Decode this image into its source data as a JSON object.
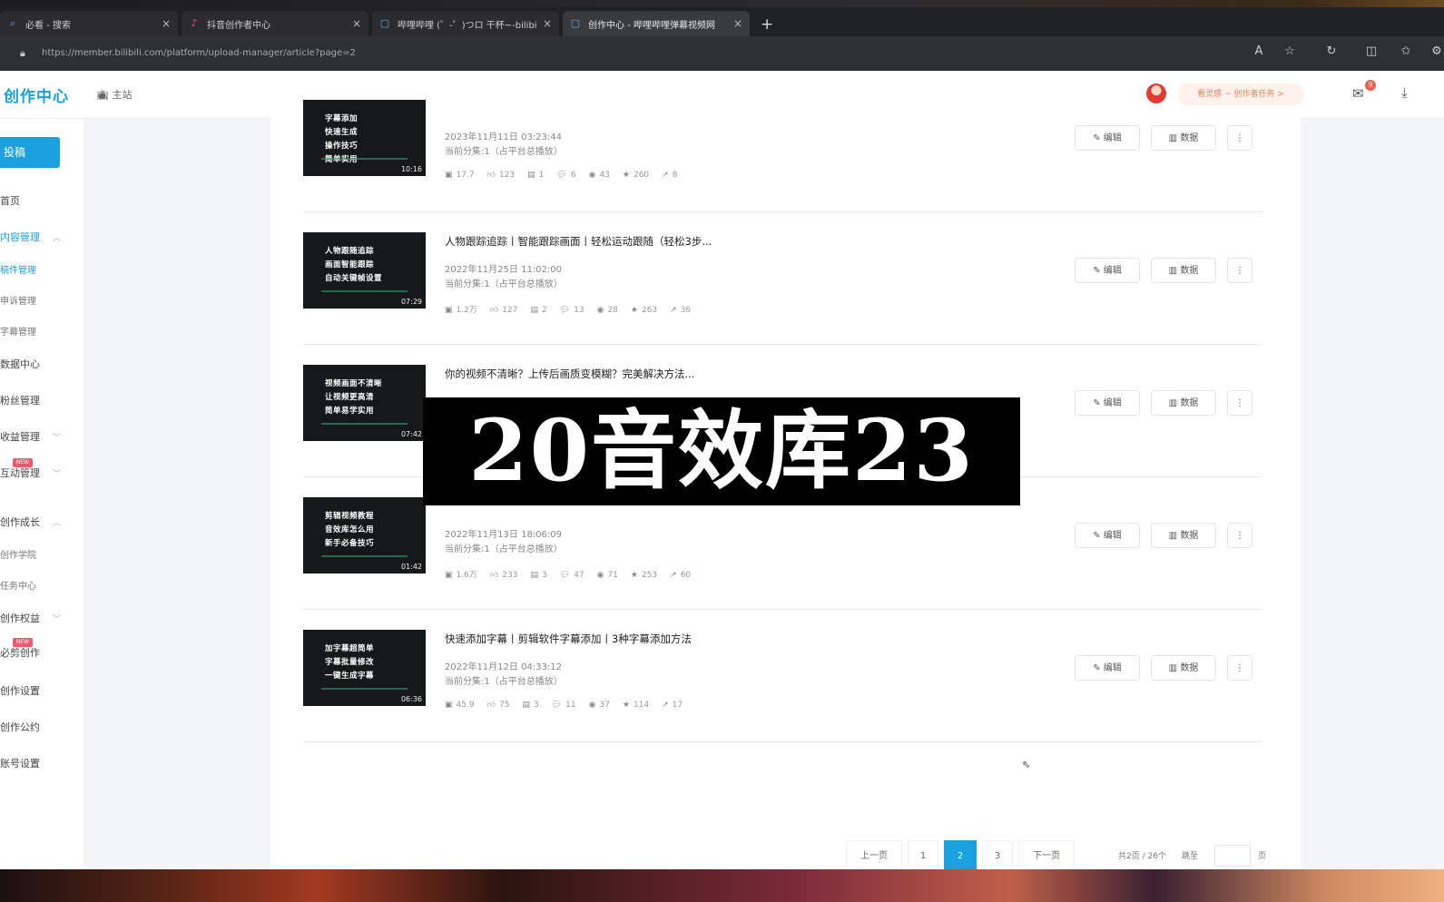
{
  "browser": {
    "tabs": [
      {
        "label": "必看 - 搜索",
        "icon": "search"
      },
      {
        "label": "抖音创作者中心",
        "icon": "douyin"
      },
      {
        "label": "哔哩哔哩 (゜-゜)つロ 干杯~-bilibili",
        "icon": "bilibili"
      },
      {
        "label": "创作中心 - 哔哩哔哩弹幕视频网",
        "icon": "bilibili"
      }
    ],
    "url": "https://member.bilibili.com/platform/upload-manager/article?page=2"
  },
  "header": {
    "brand": "创作中心",
    "home_label": "主站",
    "promo": "看灵感 ~ 创作者任务 >",
    "msg_count": "9"
  },
  "sidebar": {
    "upload": "投稿",
    "items": [
      {
        "label": "首页"
      },
      {
        "label": "内容管理"
      },
      {
        "label": "稿件管理"
      },
      {
        "label": "申诉管理"
      },
      {
        "label": "字幕管理"
      },
      {
        "label": "数据中心"
      },
      {
        "label": "粉丝管理"
      },
      {
        "label": "收益管理"
      },
      {
        "label": "互动管理"
      },
      {
        "label": "创作成长"
      },
      {
        "label": "创作学院"
      },
      {
        "label": "任务中心"
      },
      {
        "label": "创作权益"
      },
      {
        "label": "必剪创作"
      },
      {
        "label": "创作设置"
      },
      {
        "label": "创作公约"
      },
      {
        "label": "账号设置"
      }
    ]
  },
  "videos": [
    {
      "thumb_caption": "字幕添加\n快速生成\n操作技巧\n简单实用",
      "duration": "10:16",
      "title": "",
      "date": "2023年11月11日 03:23:44",
      "sub": "当前分集:1（占平台总播放）",
      "stats": {
        "play": "17.7",
        "like": "123",
        "danmaku": "1",
        "comment": "6",
        "coin": "43",
        "fav": "260",
        "share": "8"
      }
    },
    {
      "thumb_caption": "人物跟随追踪\n画面智能跟踪\n自动关键帧设置",
      "duration": "07:29",
      "title": "人物跟踪追踪丨智能跟踪画面丨轻松运动跟随（轻松3步...",
      "date": "2022年11月25日 11:02:00",
      "sub": "当前分集:1（占平台总播放）",
      "stats": {
        "play": "1.2万",
        "like": "127",
        "danmaku": "2",
        "comment": "13",
        "coin": "28",
        "fav": "263",
        "share": "36"
      }
    },
    {
      "thumb_caption": "视频画面不清晰\n让视频更高清\n简单易学实用",
      "duration": "07:42",
      "title": "你的视频不清晰？上传后画质变模糊？完美解决方法...",
      "date": "",
      "sub": "",
      "stats": null
    },
    {
      "thumb_caption": "剪辑视频教程\n音效库怎么用\n新手必备技巧",
      "duration": "01:42",
      "title": "",
      "date": "2022年11月13日 18:06:09",
      "sub": "当前分集:1（占平台总播放）",
      "stats": {
        "play": "1.6万",
        "like": "233",
        "danmaku": "3",
        "comment": "47",
        "coin": "71",
        "fav": "253",
        "share": "60"
      }
    },
    {
      "thumb_caption": "加字幕超简单\n字幕批量修改\n一键生成字幕",
      "duration": "06:36",
      "title": "快速添加字幕丨剪辑软件字幕添加丨3种字幕添加方法",
      "date": "2022年11月12日 04:33:12",
      "sub": "当前分集:1（占平台总播放）",
      "stats": {
        "play": "45.9",
        "like": "75",
        "danmaku": "3",
        "comment": "11",
        "coin": "37",
        "fav": "114",
        "share": "17"
      }
    }
  ],
  "actions": {
    "edit": "编辑",
    "data": "数据",
    "more": "⋮"
  },
  "pagination": {
    "prev": "上一页",
    "pages": [
      "1",
      "2",
      "3"
    ],
    "current": "2",
    "next": "下一页",
    "total": "共2页 / 26个",
    "jump_label": "跳至",
    "jump_suffix": "页"
  },
  "overlay_text": "20音效库23"
}
